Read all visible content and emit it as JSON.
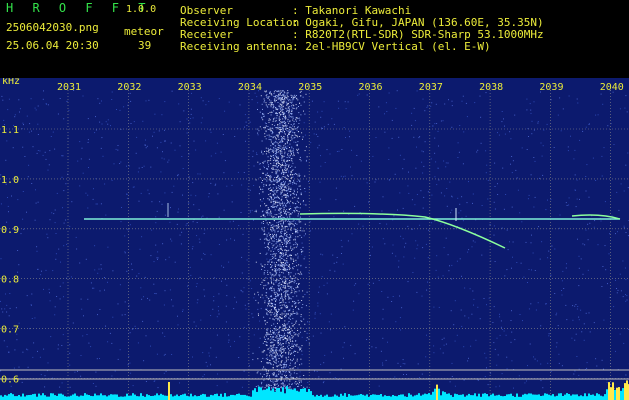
{
  "header": {
    "brand": "H R O F F T",
    "version": "1.0.0",
    "filename": "2506042030.png",
    "datetime": "25.06.04 20:30",
    "meteor_label": "meteor",
    "meteor_count": "39",
    "info": [
      {
        "label": "Observer",
        "value": ": Takanori Kawachi"
      },
      {
        "label": "Receiving Location",
        "value": ": Ogaki, Gifu, JAPAN (136.60E, 35.35N)"
      },
      {
        "label": "Receiver",
        "value": ": R820T2(RTL-SDR) SDR-Sharp 53.1000MHz"
      },
      {
        "label": "Receiving antenna",
        "value": ": 2el-HB9CV Vertical (el. E-W)"
      }
    ]
  },
  "spectrogram": {
    "unit": "kHz",
    "time_ticks": [
      "2031",
      "2032",
      "2033",
      "2034",
      "2035",
      "2036",
      "2037",
      "2038",
      "2039",
      "2040"
    ],
    "freq_ticks": [
      "1.1",
      "1.0",
      "0.9",
      "0.8",
      "0.7",
      "0.6"
    ],
    "colors": {
      "background": "#0c1a6e",
      "grid": "#8a8a8a",
      "axis_text": "#ecec3a",
      "trace": "#7ff0d8",
      "level": "#00e6ff"
    }
  }
}
